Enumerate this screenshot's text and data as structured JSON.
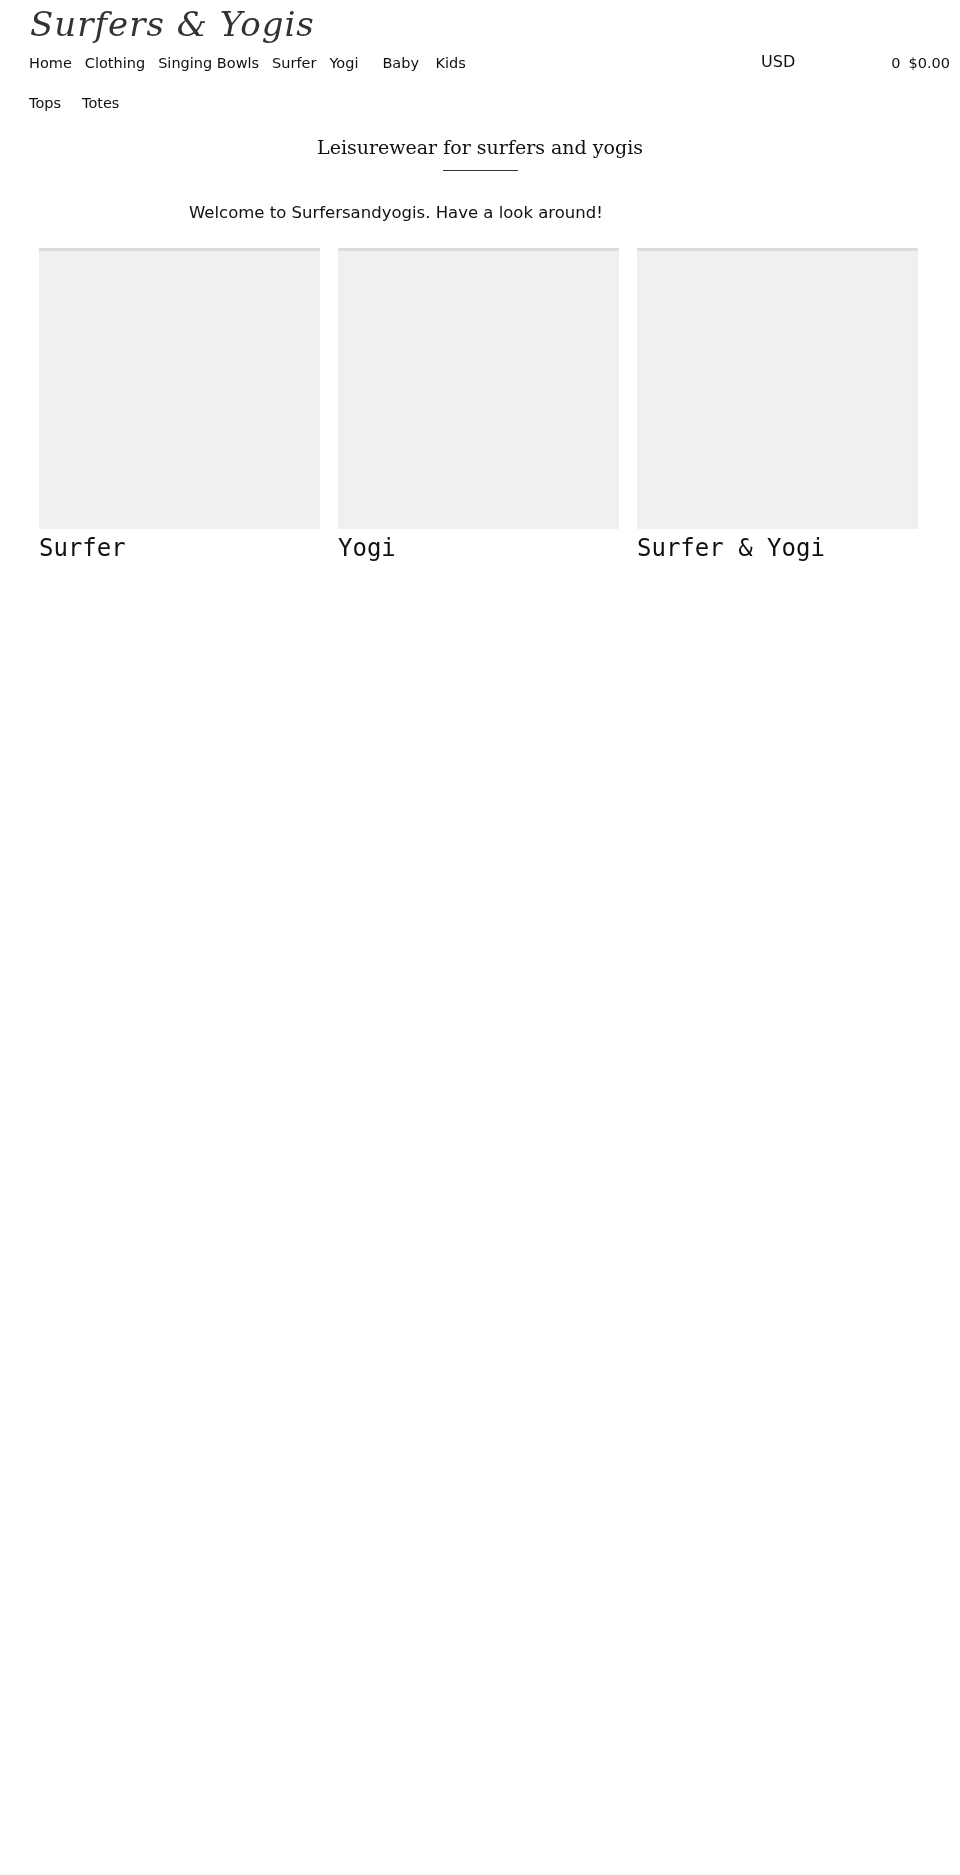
{
  "logo": "Surfers & Yogis",
  "nav": [
    "Home",
    "Clothing",
    "Singing Bowls",
    "Surfer",
    "Yogi",
    "Baby",
    "Kids",
    "Tops",
    "Totes"
  ],
  "currency": "USD",
  "cart": {
    "count": "0",
    "total": "$0.00"
  },
  "title": "Leisurewear for surfers and yogis",
  "welcome": "Welcome to Surfersandyogis. Have a look around!",
  "collections": [
    {
      "title": "Surfer"
    },
    {
      "title": "Yogi"
    },
    {
      "title": "Surfer & Yogi"
    }
  ]
}
